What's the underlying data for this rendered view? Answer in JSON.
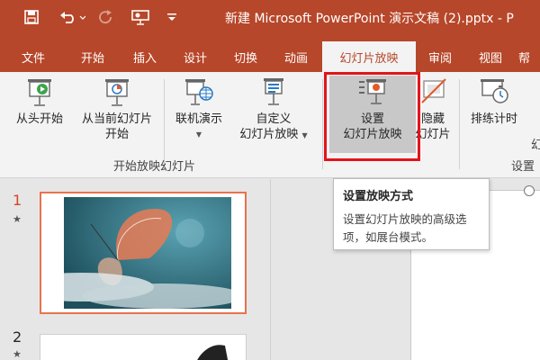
{
  "titlebar": {
    "title": "新建 Microsoft PowerPoint 演示文稿 (2).pptx  -  P",
    "qat_icons": [
      "save-icon",
      "undo-icon",
      "redo-icon",
      "presenter-icon",
      "customize-icon"
    ]
  },
  "tabs": [
    {
      "label": "文件"
    },
    {
      "label": "开始"
    },
    {
      "label": "插入"
    },
    {
      "label": "设计"
    },
    {
      "label": "切换"
    },
    {
      "label": "动画"
    },
    {
      "label": "幻灯片放映"
    },
    {
      "label": "审阅"
    },
    {
      "label": "视图"
    },
    {
      "label": "帮"
    }
  ],
  "active_tab": "幻灯片放映",
  "ribbon": {
    "from_start": "从头开始",
    "from_current_1": "从当前幻灯片",
    "from_current_2": "开始",
    "online": "联机演示",
    "custom_1": "自定义",
    "custom_2": "幻灯片放映",
    "group_start": "开始放映幻灯片",
    "setup_1": "设置",
    "setup_2": "幻灯片放映",
    "hide_1": "隐藏",
    "hide_2": "幻灯片",
    "rehearse": "排练计时",
    "group_setup": "设置",
    "cut_label": "幻"
  },
  "tooltip": {
    "title": "设置放映方式",
    "body": "设置幻灯片放映的高级选项，如展台模式。"
  },
  "slides": [
    {
      "number": "1",
      "star": "★"
    },
    {
      "number": "2",
      "star": "★"
    }
  ],
  "colors": {
    "accent": "#b7472a",
    "highlight_box": "#e3141b",
    "selected_thumb": "#e8734f"
  }
}
